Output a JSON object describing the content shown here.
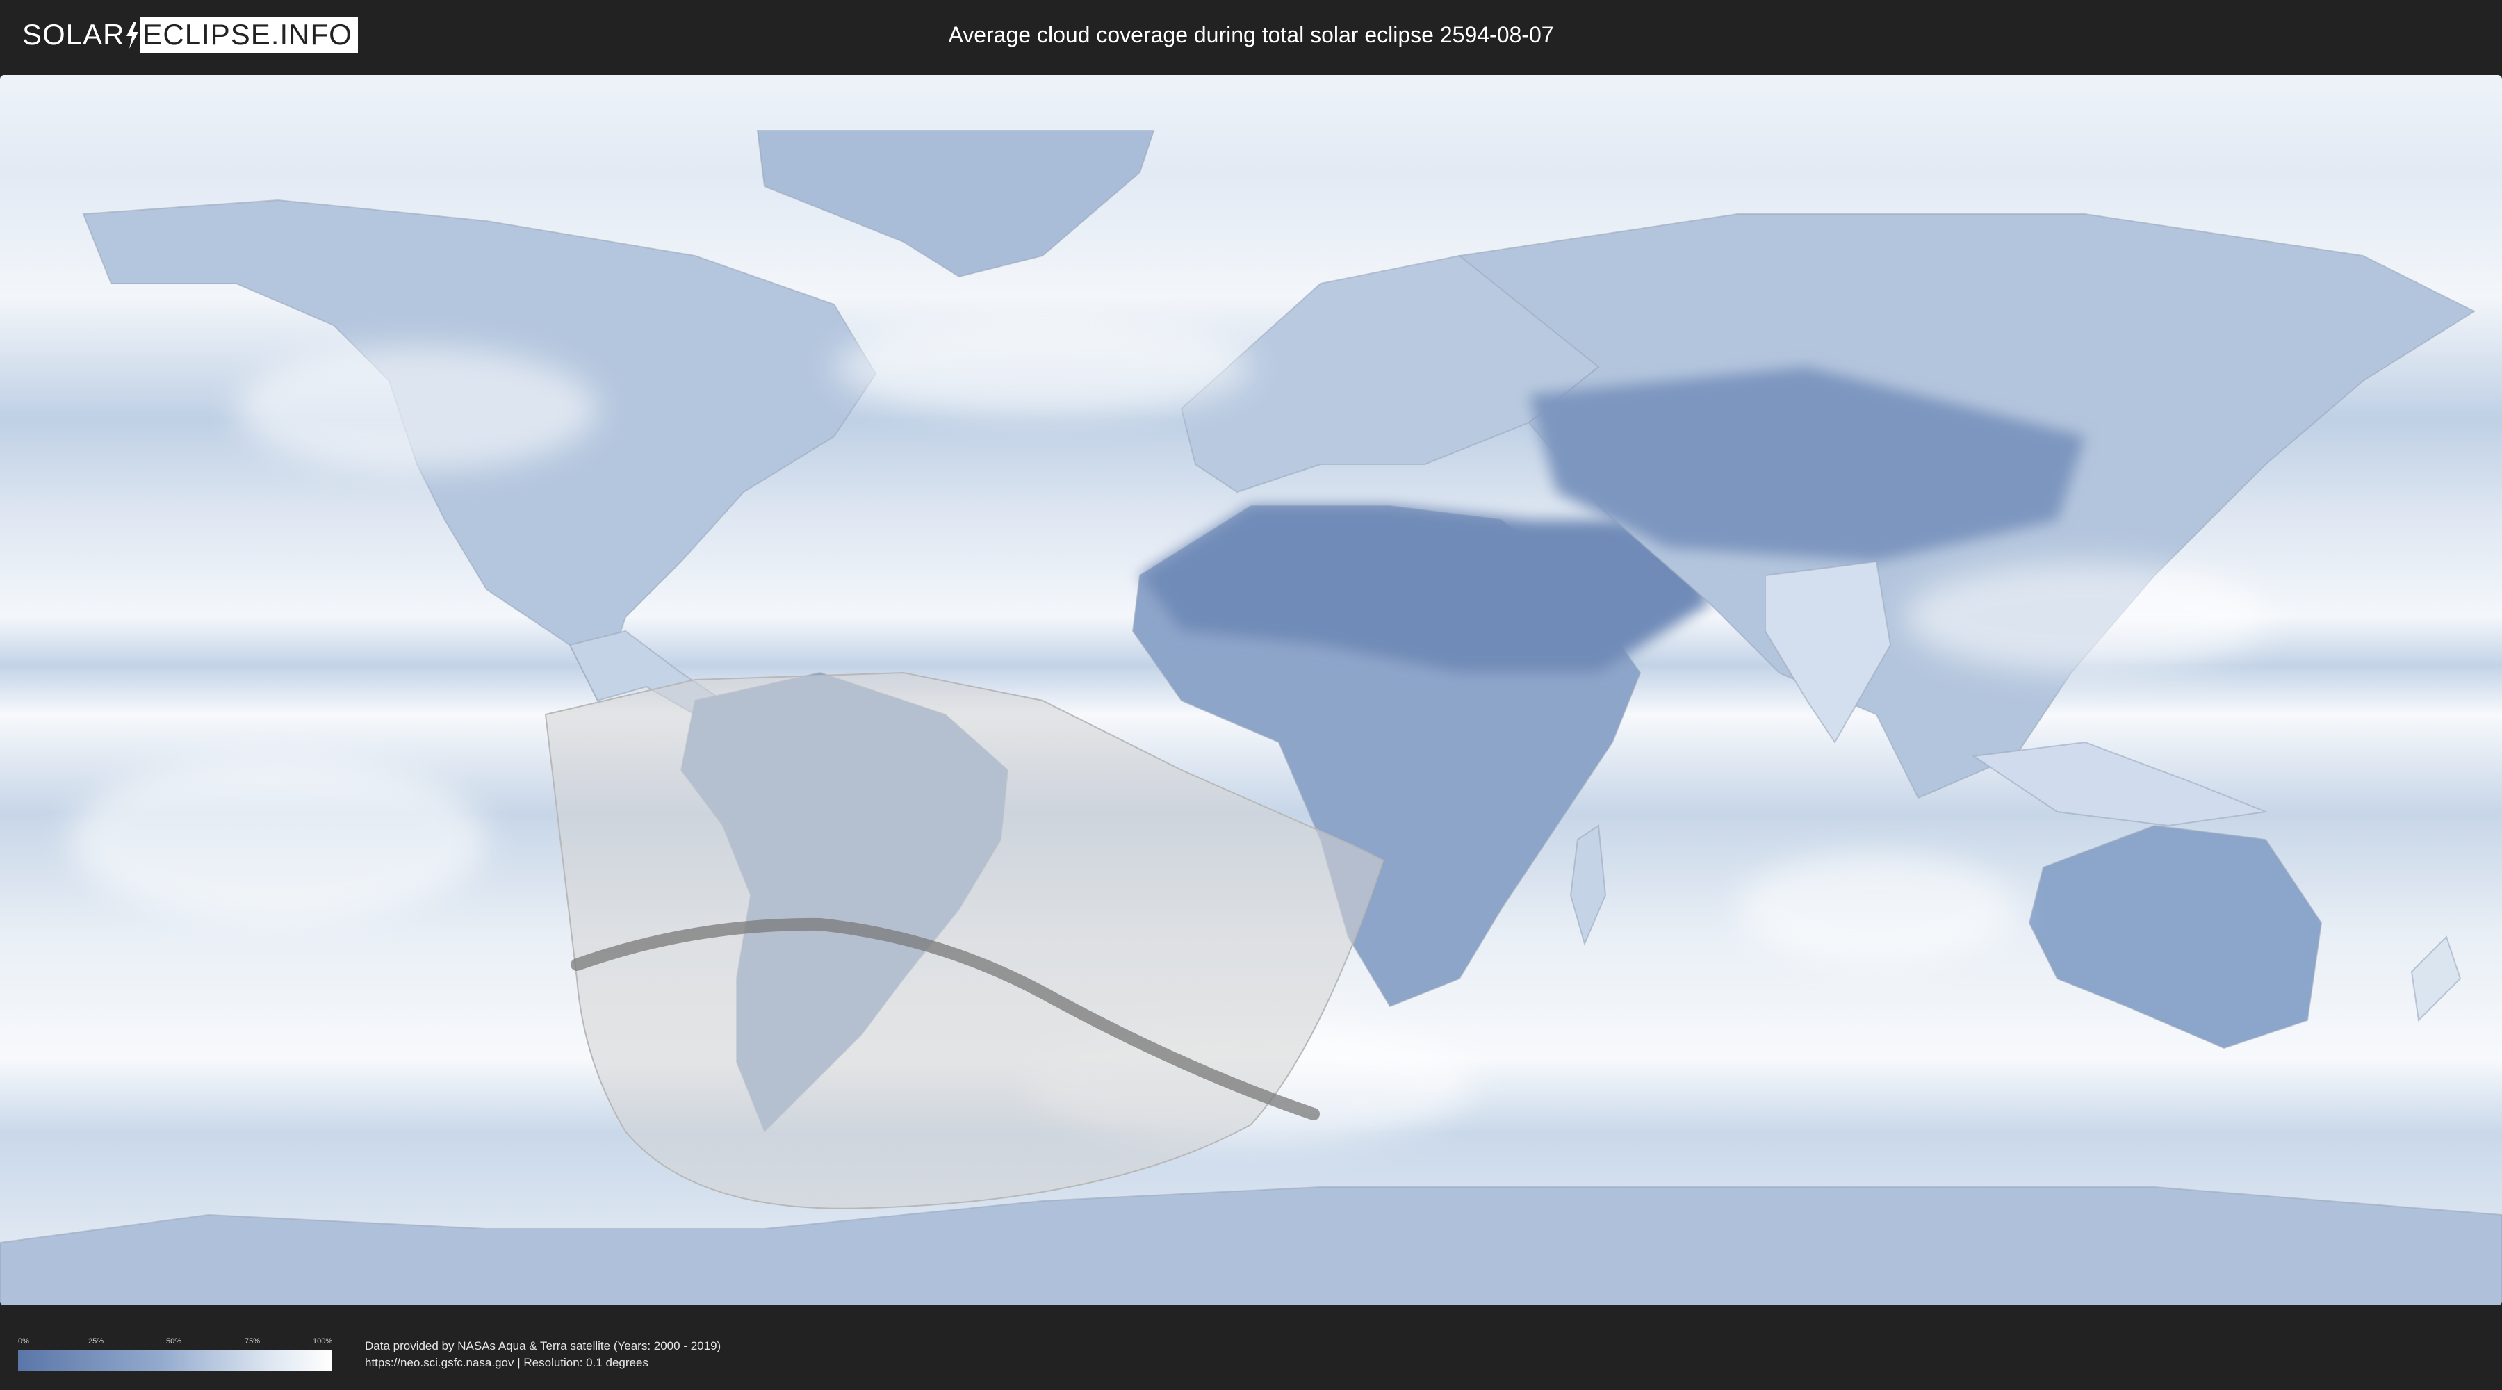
{
  "header": {
    "logo_solar": "SOLAR",
    "logo_eclipse": "ECLIPSE.INFO",
    "title": "Average cloud coverage during total solar eclipse 2594-08-07"
  },
  "map": {
    "overlay_colors": {
      "low_cloud": "#5a76a8",
      "high_cloud": "#ffffff",
      "eclipse_zone": "#d4d4d4",
      "totality_path": "#7a7a7a"
    }
  },
  "legend": {
    "ticks": [
      "0%",
      "25%",
      "50%",
      "75%",
      "100%"
    ]
  },
  "credits": {
    "line1": "Data provided by NASAs Aqua & Terra satellite (Years: 2000 - 2019)",
    "line2": "https://neo.sci.gsfc.nasa.gov | Resolution: 0.1 degrees"
  }
}
